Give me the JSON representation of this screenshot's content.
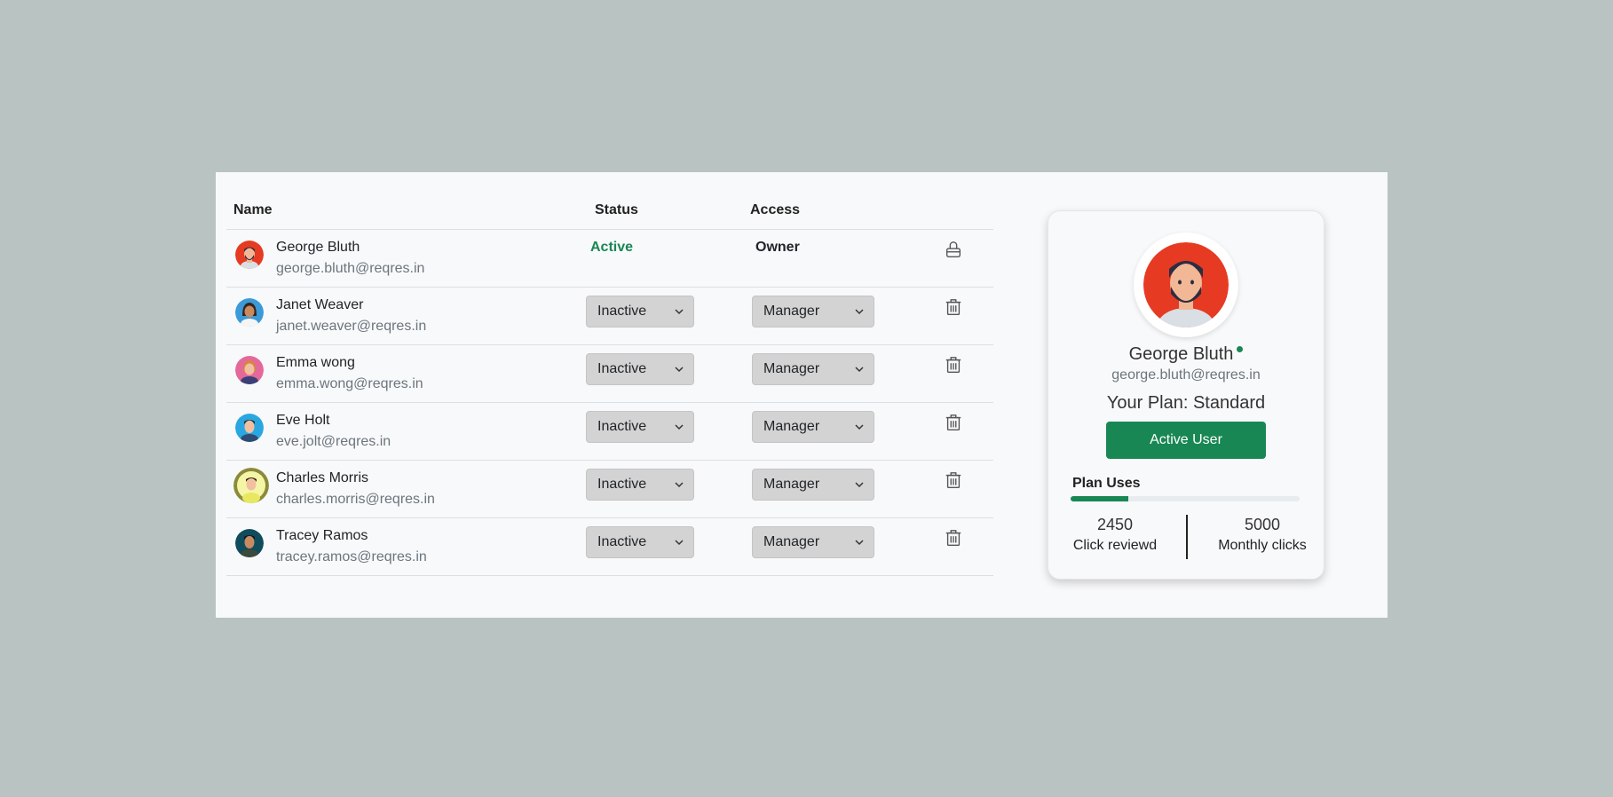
{
  "table": {
    "headers": {
      "name": "Name",
      "status": "Status",
      "access": "Access"
    },
    "rows": [
      {
        "name": "George Bluth",
        "email": "george.bluth@reqres.in",
        "status": "Active",
        "access": "Owner",
        "action_icon": "lock-icon",
        "avatar_bg": "#e63a22"
      },
      {
        "name": "Janet Weaver",
        "email": "janet.weaver@reqres.in",
        "status": "Inactive",
        "access": "Manager",
        "action_icon": "trash-icon",
        "avatar_bg": "#3b9ad9"
      },
      {
        "name": "Emma wong",
        "email": "emma.wong@reqres.in",
        "status": "Inactive",
        "access": "Manager",
        "action_icon": "trash-icon",
        "avatar_bg": "#e5689a"
      },
      {
        "name": "Eve Holt",
        "email": "eve.jolt@reqres.in",
        "status": "Inactive",
        "access": "Manager",
        "action_icon": "trash-icon",
        "avatar_bg": "#2aa7e0"
      },
      {
        "name": "Charles Morris",
        "email": "charles.morris@reqres.in",
        "status": "Inactive",
        "access": "Manager",
        "action_icon": "trash-icon",
        "avatar_bg": "#8b8a3a"
      },
      {
        "name": "Tracey Ramos",
        "email": "tracey.ramos@reqres.in",
        "status": "Inactive",
        "access": "Manager",
        "action_icon": "trash-icon",
        "avatar_bg": "#0f4c5c"
      }
    ]
  },
  "card": {
    "name": "George Bluth",
    "email": "george.bluth@reqres.in",
    "plan": "Your Plan: Standard",
    "button": "Active User",
    "plan_uses_label": "Plan Uses",
    "progress_fraction": 0.25,
    "stats": {
      "left": {
        "value": "2450",
        "label": "Click reviewd"
      },
      "right": {
        "value": "5000",
        "label": "Monthly clicks"
      }
    }
  },
  "colors": {
    "accent": "#198754",
    "background": "#b8c3c2",
    "panel": "#f8f9fa",
    "select_bg": "#d3d3d3"
  }
}
